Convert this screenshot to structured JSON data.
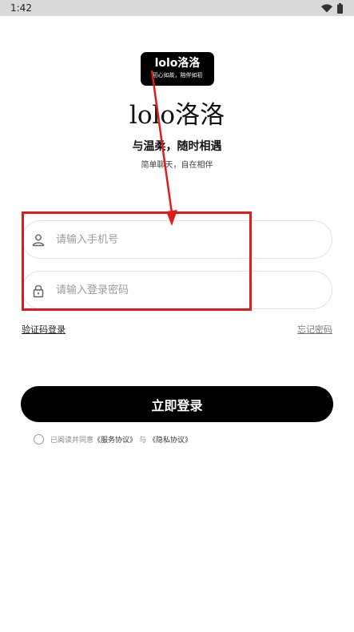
{
  "status_bar": {
    "time": "1:42",
    "icons": [
      "wifi-icon",
      "battery-icon"
    ]
  },
  "logo": {
    "title": "lolo洛洛",
    "subtitle": "初心如故，陪伴如初"
  },
  "header": {
    "app_name": "lolo洛洛",
    "slogan": "与温柔，随时相遇",
    "subslogan": "简单聊天，自在相伴"
  },
  "form": {
    "phone_placeholder": "请输入手机号",
    "phone_value": "",
    "password_placeholder": "请输入登录密码",
    "password_value": "",
    "sms_login_label": "验证码登录",
    "forgot_password_label": "忘记密码",
    "login_button_label": "立即登录"
  },
  "agreement": {
    "prefix": "已阅读并同意",
    "service_link": "《服务协议》",
    "separator": "与",
    "privacy_link": "《隐私协议》",
    "checked": false
  },
  "colors": {
    "primary": "#000000",
    "annotation": "#e01b1b",
    "border": "#e2e2e2",
    "placeholder": "#9a9a9a"
  }
}
